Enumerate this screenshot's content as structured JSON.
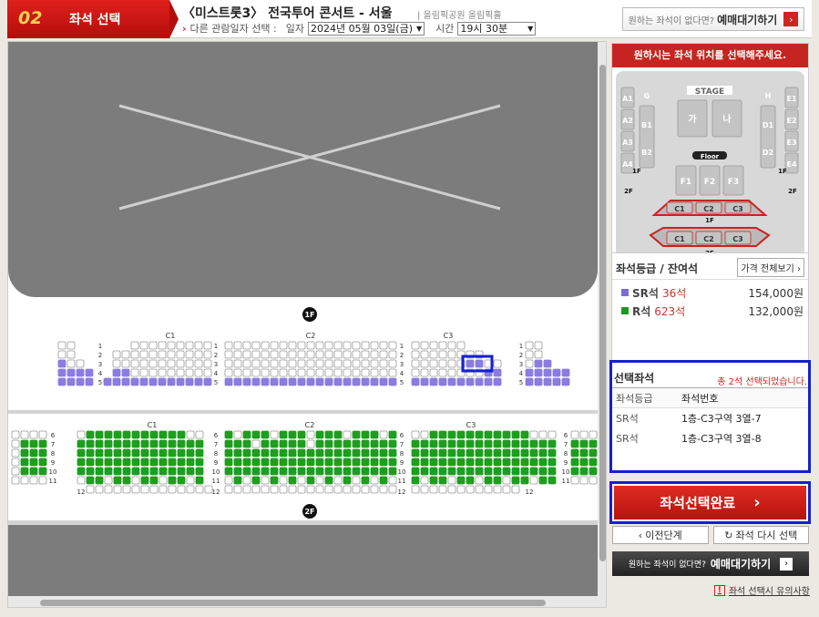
{
  "header": {
    "step_num": "02",
    "step_title": "좌석 선택",
    "performance_title": "〈미스트롯3〉 전국투어 콘서트 - 서울",
    "venue": "| 올림픽공원 올림픽홀",
    "other_date_label": "다른 관람일자 선택 :",
    "date_label": "일자",
    "date_value": "2024년 05월 03일(금)",
    "time_label": "시간",
    "time_value": "19시 30분",
    "wait_small": "원하는 좌석이 없다면?",
    "wait_big": "예매대기하기"
  },
  "seatmap": {
    "floor1_badge": "1F",
    "floor2_badge": "2F",
    "upper_sections": [
      "C1",
      "C2",
      "C3"
    ],
    "lower_sections": [
      "C1",
      "C2",
      "C3"
    ],
    "upper_rows": [
      "1",
      "2",
      "3",
      "4",
      "5"
    ],
    "lower_rows": [
      "6",
      "7",
      "8",
      "9",
      "10",
      "11"
    ],
    "lower_end_row": "12",
    "selected_seats": [
      [
        3,
        7
      ],
      [
        3,
        8
      ]
    ]
  },
  "minimap": {
    "header": "원하시는 좌석 위치를 선택해주세요.",
    "stage": "STAGE",
    "floor": "Floor",
    "left_a": [
      "A1",
      "A2",
      "A3",
      "A4"
    ],
    "right_e": [
      "E1",
      "E2",
      "E3",
      "E4"
    ],
    "g": "G",
    "h": "H",
    "b": [
      "B1",
      "B2"
    ],
    "d": [
      "D1",
      "D2"
    ],
    "ga": "가",
    "na": "나",
    "f": [
      "F1",
      "F2",
      "F3"
    ],
    "c_upper": [
      "C1",
      "C2",
      "C3"
    ],
    "c_lower": [
      "C1",
      "C2",
      "C3"
    ],
    "badge_1f": "1F",
    "badge_2f": "2F"
  },
  "grades": {
    "title": "좌석등급 / 잔여석",
    "view_all": "가격 전체보기",
    "items": [
      {
        "name": "SR석",
        "count": "36석",
        "price": "154,000원",
        "color": "#7e6bd8"
      },
      {
        "name": "R석",
        "count": "623석",
        "price": "132,000원",
        "color": "#1c9a1c"
      }
    ]
  },
  "selected": {
    "title": "선택좌석",
    "count_msg": "총 2석 선택되었습니다.",
    "col_grade": "좌석등급",
    "col_seat": "좌석번호",
    "rows": [
      {
        "grade": "SR석",
        "seat": "1층-C3구역 3열-7"
      },
      {
        "grade": "SR석",
        "seat": "1층-C3구역 3열-8"
      }
    ]
  },
  "actions": {
    "complete": "좌석선택완료",
    "prev": "이전단계",
    "reselect": "좌석 다시 선택",
    "wait_small": "원하는 좌석이 없다면?",
    "wait_big": "예매대기하기",
    "caution": "좌석 선택시 유의사항"
  },
  "colors": {
    "accent": "#d1241f",
    "sr": "#7e6bd8",
    "r": "#1c9a1c",
    "highlight": "#1520d0"
  }
}
